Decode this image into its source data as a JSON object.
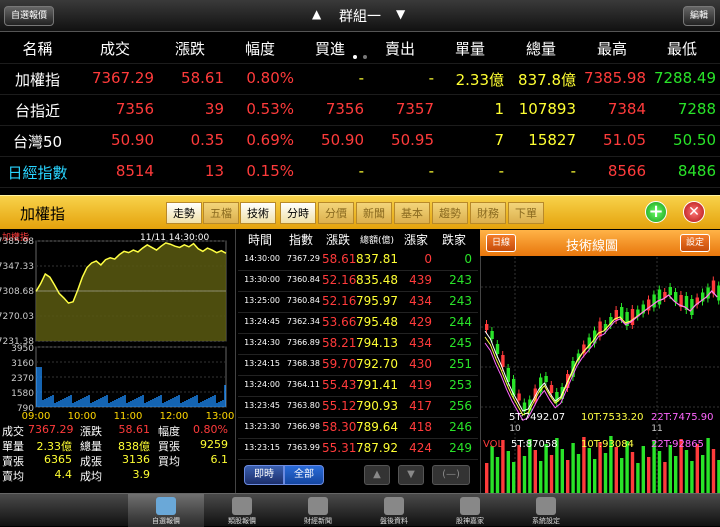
{
  "topbar": {
    "left_button": "自選報價",
    "group_title": "群組一",
    "right_button": "編輯",
    "prev_arrow": "▲",
    "next_arrow": "▼"
  },
  "quote_headers": [
    "名稱",
    "成交",
    "漲跌",
    "幅度",
    "買進",
    "賣出",
    "單量",
    "總量",
    "最高",
    "最低"
  ],
  "quotes": [
    {
      "name": "加權指",
      "price": "7367.29",
      "change": "58.61",
      "pct": "0.80%",
      "bid": "-",
      "ask": "-",
      "vol": "2.33億",
      "total": "837.8億",
      "high": "7385.98",
      "low": "7288.49"
    },
    {
      "name": "台指近",
      "price": "7356",
      "change": "39",
      "pct": "0.53%",
      "bid": "7356",
      "ask": "7357",
      "vol": "1",
      "total": "107893",
      "high": "7384",
      "low": "7288"
    },
    {
      "name": "台灣50",
      "price": "50.90",
      "change": "0.35",
      "pct": "0.69%",
      "bid": "50.90",
      "ask": "50.95",
      "vol": "7",
      "total": "15827",
      "high": "51.05",
      "low": "50.50"
    },
    {
      "name": "日經指數",
      "price": "8514",
      "change": "13",
      "pct": "0.15%",
      "bid": "-",
      "ask": "-",
      "vol": "-",
      "total": "-",
      "high": "8566",
      "low": "8486"
    }
  ],
  "midbar": {
    "stock_name": "加權指",
    "tabs": [
      "走勢",
      "五檔",
      "技術",
      "分時",
      "分價",
      "新聞",
      "基本",
      "趨勢",
      "財務",
      "下單"
    ],
    "active_tabs": [
      "走勢",
      "技術",
      "分時"
    ],
    "plus": "+",
    "close": "✕"
  },
  "intraday": {
    "title": "加權指",
    "datetime": "11/11 14:30:00",
    "price_ticks": [
      "7385.98",
      "7347.33",
      "7308.68",
      "7270.03",
      "7231.38"
    ],
    "volume_ticks": [
      "3950",
      "3160",
      "2370",
      "1580",
      "790"
    ],
    "time_ticks": [
      "09:00",
      "10:00",
      "11:00",
      "12:00",
      "13:00"
    ],
    "prices": [
      7308,
      7320,
      7335,
      7330,
      7318,
      7305,
      7298,
      7290,
      7292,
      7310,
      7330,
      7345,
      7352,
      7355,
      7349,
      7357,
      7360,
      7358,
      7365,
      7370,
      7368,
      7372,
      7369,
      7375,
      7380,
      7376,
      7372,
      7378,
      7383,
      7381,
      7378,
      7376,
      7380,
      7377,
      7382,
      7374,
      7370,
      7375,
      7372,
      7368,
      7371,
      7367
    ]
  },
  "stats": [
    [
      {
        "l": "成交",
        "v": "7367.29"
      },
      {
        "l": "漲跌",
        "v": "58.61"
      },
      {
        "l": "幅度",
        "v": "0.80%"
      }
    ],
    [
      {
        "l": "單量",
        "v": "2.33億"
      },
      {
        "l": "總量",
        "v": "838億"
      },
      {
        "l": "買張",
        "v": "9259"
      }
    ],
    [
      {
        "l": "賣張",
        "v": "6365"
      },
      {
        "l": "成張",
        "v": "3136"
      },
      {
        "l": "買均",
        "v": "6.1"
      }
    ],
    [
      {
        "l": "賣均",
        "v": "4.4"
      },
      {
        "l": "成均",
        "v": "3.9"
      }
    ]
  ],
  "ticks": {
    "headers": [
      "時間",
      "指數",
      "漲跌",
      "總額(億)",
      "漲家",
      "跌家"
    ],
    "rows": [
      [
        "14:30:00",
        "7367.29",
        "58.61",
        "837.81",
        "0",
        "0"
      ],
      [
        "13:30:00",
        "7360.84",
        "52.16",
        "835.48",
        "439",
        "243"
      ],
      [
        "13:25:00",
        "7360.84",
        "52.16",
        "795.97",
        "434",
        "243"
      ],
      [
        "13:24:45",
        "7362.34",
        "53.66",
        "795.48",
        "429",
        "244"
      ],
      [
        "13:24:30",
        "7366.89",
        "58.21",
        "794.13",
        "434",
        "245"
      ],
      [
        "13:24:15",
        "7368.38",
        "59.70",
        "792.70",
        "430",
        "251"
      ],
      [
        "13:24:00",
        "7364.11",
        "55.43",
        "791.41",
        "419",
        "253"
      ],
      [
        "13:23:45",
        "7363.80",
        "55.12",
        "790.93",
        "417",
        "256"
      ],
      [
        "13:23:30",
        "7366.98",
        "58.30",
        "789.64",
        "418",
        "246"
      ],
      [
        "13:23:15",
        "7363.99",
        "55.31",
        "787.92",
        "424",
        "249"
      ]
    ],
    "btn_instant": "即時",
    "btn_all": "全部"
  },
  "tech": {
    "title": "技術線圖",
    "left_btn": "日線",
    "right_btn": "設定",
    "ma5": "5T:7492.07",
    "ma10": "10T:7533.20",
    "ma22": "22T:7475.90",
    "x_ticks": [
      "10",
      "11"
    ],
    "vol_label": "VOL",
    "vol5": "5T:87058",
    "vol10": "10T:93084",
    "vol22": "22T:92865"
  },
  "nav": [
    {
      "label": "自選報價"
    },
    {
      "label": "類股報價"
    },
    {
      "label": "財經新聞"
    },
    {
      "label": "盤後資料"
    },
    {
      "label": "股神嘉家"
    },
    {
      "label": "系統設定"
    }
  ],
  "colors": {
    "up": "#ff3b3b",
    "down": "#29e329",
    "accent": "#f2b82c",
    "volume": "#1e90ff"
  }
}
